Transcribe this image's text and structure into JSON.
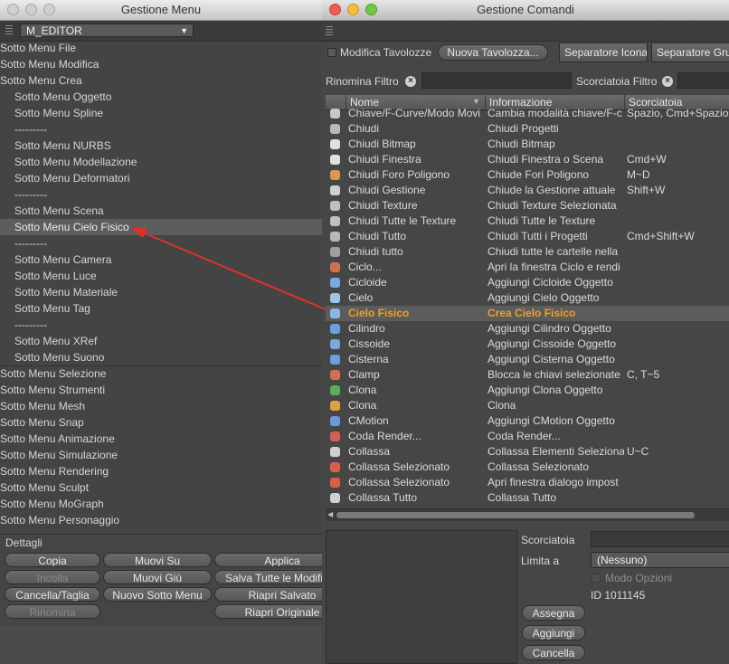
{
  "menu_window": {
    "title": "Gestione Menu",
    "dropdown_value": "M_EDITOR",
    "items": [
      {
        "label": "Sotto Menu File",
        "indent": 0
      },
      {
        "label": "Sotto Menu Modifica",
        "indent": 0
      },
      {
        "label": "Sotto Menu Crea",
        "indent": 0
      },
      {
        "label": "Sotto Menu Oggetto",
        "indent": 1
      },
      {
        "label": "Sotto Menu Spline",
        "indent": 1
      },
      {
        "label": "---------",
        "indent": 1
      },
      {
        "label": "Sotto Menu NURBS",
        "indent": 1
      },
      {
        "label": "Sotto Menu Modellazione",
        "indent": 1
      },
      {
        "label": "Sotto Menu Deformatori",
        "indent": 1
      },
      {
        "label": "---------",
        "indent": 1
      },
      {
        "label": "Sotto Menu Scena",
        "indent": 1
      },
      {
        "label": "Sotto Menu Cielo Fisico",
        "indent": 1,
        "selected": true
      },
      {
        "label": "---------",
        "indent": 1
      },
      {
        "label": "Sotto Menu Camera",
        "indent": 1
      },
      {
        "label": "Sotto Menu Luce",
        "indent": 1
      },
      {
        "label": "Sotto Menu Materiale",
        "indent": 1
      },
      {
        "label": "Sotto Menu Tag",
        "indent": 1
      },
      {
        "label": "---------",
        "indent": 1
      },
      {
        "label": "Sotto Menu XRef",
        "indent": 1
      },
      {
        "label": "Sotto Menu Suono",
        "indent": 1
      },
      {
        "label": "Sotto Menu Selezione",
        "indent": 0
      },
      {
        "label": "Sotto Menu Strumenti",
        "indent": 0
      },
      {
        "label": "Sotto Menu Mesh",
        "indent": 0
      },
      {
        "label": "Sotto Menu Snap",
        "indent": 0
      },
      {
        "label": "Sotto Menu Animazione",
        "indent": 0
      },
      {
        "label": "Sotto Menu Simulazione",
        "indent": 0
      },
      {
        "label": "Sotto Menu Rendering",
        "indent": 0
      },
      {
        "label": "Sotto Menu Sculpt",
        "indent": 0
      },
      {
        "label": "Sotto Menu MoGraph",
        "indent": 0
      },
      {
        "label": "Sotto Menu Personaggio",
        "indent": 0
      }
    ],
    "details_label": "Dettagli",
    "buttons": {
      "copia": "Copia",
      "muovi_su": "Muovi Su",
      "applica": "Applica",
      "incolla": "Incolla",
      "muovi_giu": "Muovi Giù",
      "salva_tutte": "Salva Tutte le Modifiche",
      "cancella_taglia": "Cancella/Taglia",
      "nuovo_sotto_menu": "Nuovo Sotto Menu",
      "riapri_salvato": "Riapri Salvato",
      "rinomina": "Rinomina",
      "riapri_originale": "Riapri Originale"
    }
  },
  "commands_window": {
    "title": "Gestione Comandi",
    "modifica_tavolozze": "Modifica Tavolozze",
    "nuova_tavolozza": "Nuova Tavolozza...",
    "separatore_icona": "Separatore Icona",
    "separatore_gruppo": "Separatore Gruppo",
    "rinomina_filtro": "Rinomina Filtro",
    "scorciatoia_filtro": "Scorciatoia Filtro",
    "columns": {
      "nome": "Nome",
      "informazione": "Informazione",
      "scorciatoia": "Scorciatoia"
    },
    "rows": [
      {
        "name": "Chiave/F-Curve/Modo Movi",
        "info": "Cambia modalità chiave/F-c",
        "key": "Spazio, Cmd+Spazio",
        "icon": "#c8c8c8"
      },
      {
        "name": "Chiudi",
        "info": "Chiudi Progetti",
        "key": "",
        "icon": "#b8b8b8"
      },
      {
        "name": "Chiudi Bitmap",
        "info": "Chiudi Bitmap",
        "key": "",
        "icon": "#e0e0e0"
      },
      {
        "name": "Chiudi Finestra",
        "info": "Chiudi Finestra o Scena",
        "key": "Cmd+W",
        "icon": "#e0e0e0"
      },
      {
        "name": "Chiudi Foro Poligono",
        "info": "Chiude Fori Poligono",
        "key": "M~D",
        "icon": "#d89a50"
      },
      {
        "name": "Chiudi Gestione",
        "info": "Chiude la Gestione attuale",
        "key": "Shift+W",
        "icon": "#d0d0d0"
      },
      {
        "name": "Chiudi Texture",
        "info": "Chiudi Texture Selezionata",
        "key": "",
        "icon": "#c0c0c0"
      },
      {
        "name": "Chiudi Tutte le Texture",
        "info": "Chiudi Tutte le Texture",
        "key": "",
        "icon": "#c0c0c0"
      },
      {
        "name": "Chiudi Tutto",
        "info": "Chiudi Tutti i Progetti",
        "key": "Cmd+Shift+W",
        "icon": "#b8b8b8"
      },
      {
        "name": "Chiudi tutto",
        "info": "Chiudi tutte le cartelle nella",
        "key": "",
        "icon": "#a0a0a0"
      },
      {
        "name": "Ciclo...",
        "info": "Apri la finestra Ciclo e rendi",
        "key": "",
        "icon": "#d07050"
      },
      {
        "name": "Cicloide",
        "info": "Aggiungi Cicloide Oggetto",
        "key": "",
        "icon": "#7aa8e0"
      },
      {
        "name": "Cielo",
        "info": "Aggiungi Cielo Oggetto",
        "key": "",
        "icon": "#9ec4ea"
      },
      {
        "name": "Cielo Fisico",
        "info": "Crea Cielo Fisico",
        "key": "",
        "icon": "#8ab8e6",
        "highlight": true
      },
      {
        "name": "Cilindro",
        "info": "Aggiungi Cilindro Oggetto",
        "key": "",
        "icon": "#6aa0e0"
      },
      {
        "name": "Cissoide",
        "info": "Aggiungi Cissoide Oggetto",
        "key": "",
        "icon": "#7aa8e0"
      },
      {
        "name": "Cisterna",
        "info": "Aggiungi Cisterna Oggetto",
        "key": "",
        "icon": "#6aa0e0"
      },
      {
        "name": "Clamp",
        "info": "Blocca le chiavi selezionate",
        "key": "C, T~5",
        "icon": "#d07050"
      },
      {
        "name": "Clona",
        "info": "Aggiungi Clona Oggetto",
        "key": "",
        "icon": "#58b058"
      },
      {
        "name": "Clona",
        "info": "Clona",
        "key": "",
        "icon": "#e0a040"
      },
      {
        "name": "CMotion",
        "info": "Aggiungi CMotion Oggetto",
        "key": "",
        "icon": "#6a9ad8"
      },
      {
        "name": "Coda Render...",
        "info": "Coda Render...",
        "key": "",
        "icon": "#d06050"
      },
      {
        "name": "Collassa",
        "info": "Collassa Elementi Selezionat",
        "key": "U~C",
        "icon": "#d0d0d0"
      },
      {
        "name": "Collassa Selezionato",
        "info": "Collassa Selezionato",
        "key": "",
        "icon": "#d86040"
      },
      {
        "name": "Collassa Selezionato",
        "info": "Apri finestra dialogo impost",
        "key": "",
        "icon": "#d86040"
      },
      {
        "name": "Collassa Tutto",
        "info": "Collassa Tutto",
        "key": "",
        "icon": "#d0d0d0"
      }
    ],
    "scorciatoia_label": "Scorciatoia",
    "limita_label": "Limita a",
    "limita_value": "(Nessuno)",
    "modo_opzioni": "Modo Opzioni",
    "id_label": "ID 1011145",
    "assegna": "Assegna",
    "aggiungi": "Aggiungi",
    "cancella": "Cancella"
  },
  "colors": {
    "highlight_text": "#f0a020",
    "arrow": "#e0302a"
  }
}
